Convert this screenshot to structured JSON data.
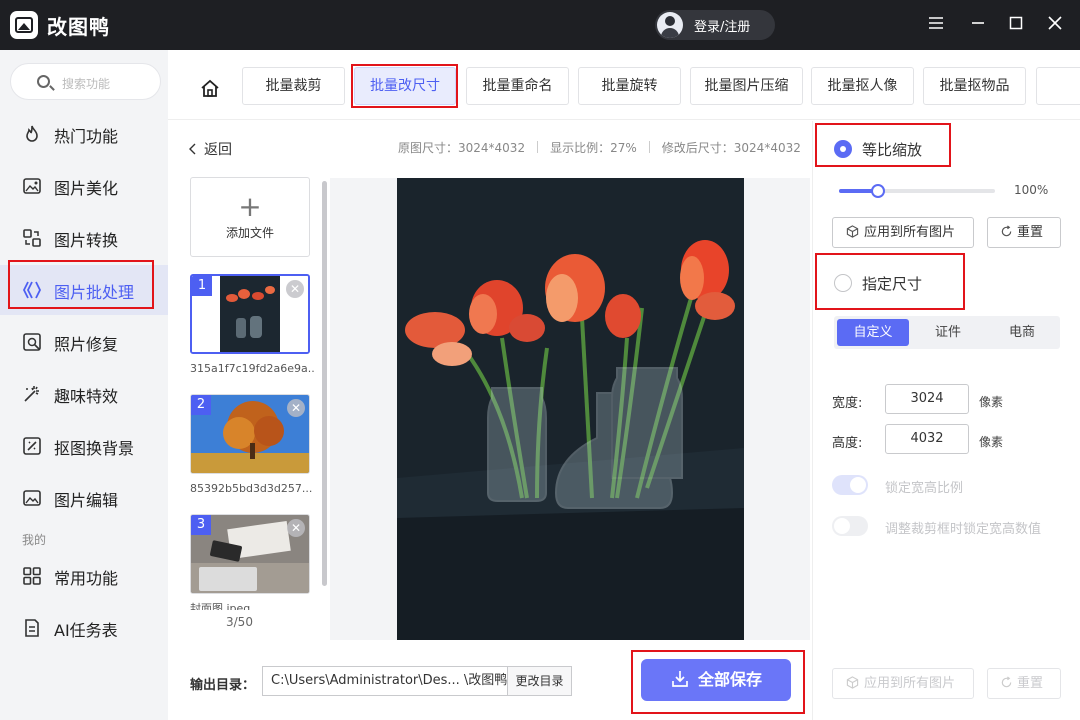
{
  "app": {
    "title": "改图鸭",
    "login": "登录/注册"
  },
  "window": {
    "menu_icon": "menu-icon",
    "minimize_icon": "minimize-icon",
    "maximize_icon": "maximize-icon",
    "close_icon": "close-icon"
  },
  "sidebar": {
    "search_placeholder": "搜索功能",
    "items": [
      {
        "label": "热门功能",
        "icon": "flame-icon"
      },
      {
        "label": "图片美化",
        "icon": "image-beautify-icon"
      },
      {
        "label": "图片转换",
        "icon": "convert-icon"
      },
      {
        "label": "图片批处理",
        "icon": "batch-icon",
        "active": true
      },
      {
        "label": "照片修复",
        "icon": "repair-icon"
      },
      {
        "label": "趣味特效",
        "icon": "sparkle-icon"
      },
      {
        "label": "抠图换背景",
        "icon": "cutout-icon"
      },
      {
        "label": "图片编辑",
        "icon": "edit-icon"
      }
    ],
    "mine_label": "我的",
    "mine_items": [
      {
        "label": "常用功能",
        "icon": "grid-icon"
      },
      {
        "label": "AI任务表",
        "icon": "task-icon"
      }
    ]
  },
  "toolbar": {
    "tabs": [
      "批量裁剪",
      "批量改尺寸",
      "批量重命名",
      "批量旋转",
      "批量图片压缩",
      "批量抠人像",
      "批量抠物品"
    ],
    "active_tab": "批量改尺寸"
  },
  "files": {
    "back": "返回",
    "add_file": "添加文件",
    "items": [
      {
        "num": "1",
        "name": "315a1f7c19fd2a6e9a..."
      },
      {
        "num": "2",
        "name": "85392b5bd3d3d257..."
      },
      {
        "num": "3",
        "name": "封面图.jpeg"
      }
    ],
    "count": "3/50"
  },
  "info": {
    "original": "原图尺寸：3024*4032",
    "ratio": "显示比例：27%",
    "modified": "修改后尺寸：3024*4032"
  },
  "output": {
    "label": "输出目录：",
    "path": "C:\\Users\\Administrator\\Des... \\改图鸭",
    "change": "更改目录",
    "save_all": "全部保存"
  },
  "settings": {
    "proportional": "等比缩放",
    "scale_value": "100%",
    "scale_fraction": 0.25,
    "apply_all": "应用到所有图片",
    "reset": "重置",
    "specify": "指定尺寸",
    "segments": [
      "自定义",
      "证件",
      "电商"
    ],
    "width_label": "宽度:",
    "width": "3024",
    "height_label": "高度:",
    "height": "4032",
    "unit": "像素",
    "lock_ratio": "锁定宽高比例",
    "lock_crop": "调整裁剪框时锁定宽高数值"
  },
  "colors": {
    "accent": "#4d5ff2",
    "titlebar": "#1e1f23",
    "highlight": "#e2141a"
  }
}
